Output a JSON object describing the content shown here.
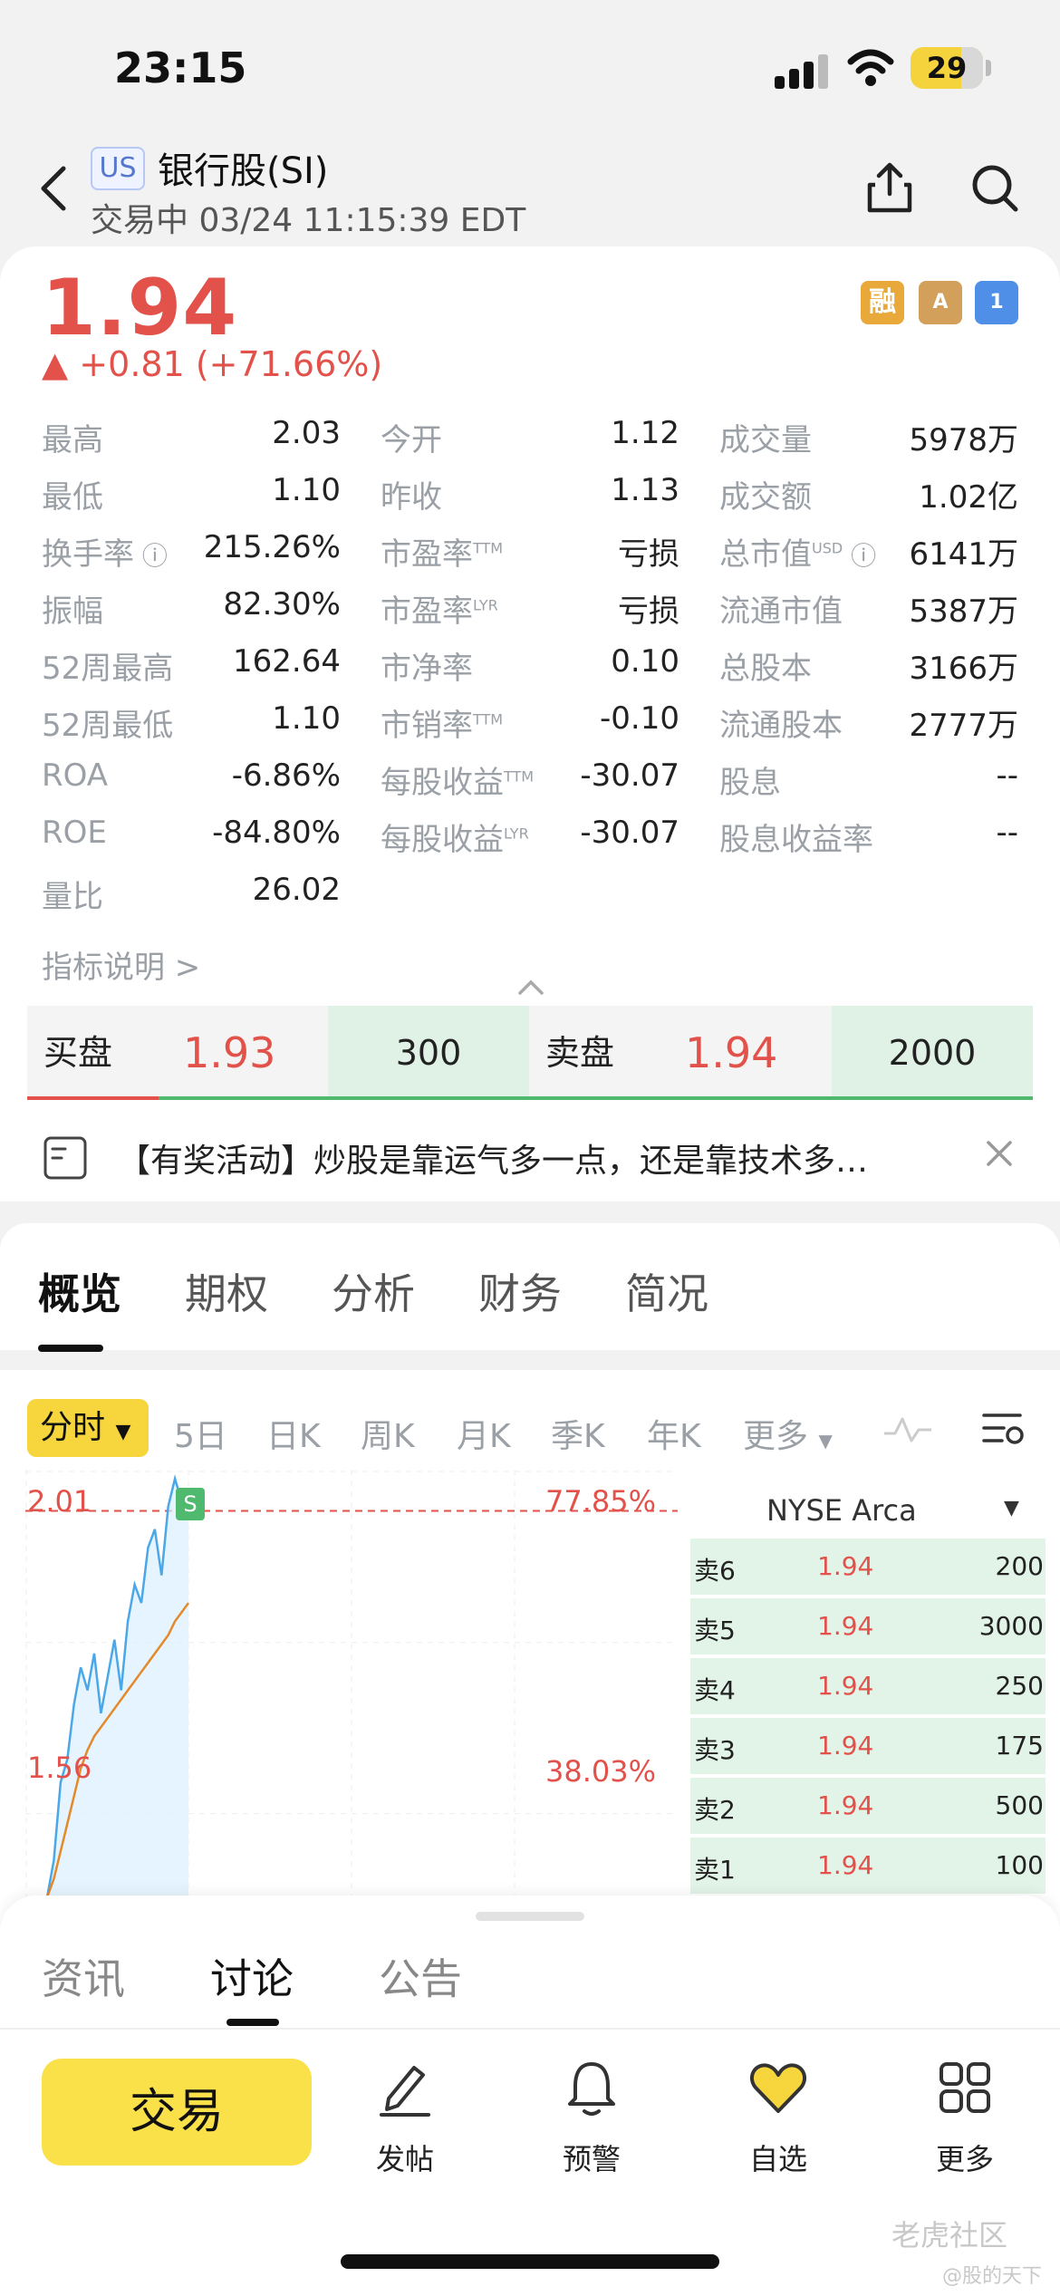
{
  "status": {
    "time": "23:15",
    "battery": "29"
  },
  "header": {
    "market": "US",
    "name": "银行股(SI)",
    "subtitle": "交易中 03/24 11:15:39 EDT"
  },
  "quote": {
    "price": "1.94",
    "change": "▲ +0.81 (+71.66%)",
    "badges": [
      "融",
      "A",
      "1"
    ]
  },
  "stats": {
    "col1": [
      {
        "label": "最高",
        "value": "2.03"
      },
      {
        "label": "最低",
        "value": "1.10"
      },
      {
        "label": "换手率",
        "value": "215.26%"
      },
      {
        "label": "振幅",
        "value": "82.30%"
      },
      {
        "label": "52周最高",
        "value": "162.64"
      },
      {
        "label": "52周最低",
        "value": "1.10"
      },
      {
        "label": "ROA",
        "value": "-6.86%"
      },
      {
        "label": "ROE",
        "value": "-84.80%"
      },
      {
        "label": "量比",
        "value": "26.02"
      }
    ],
    "col2": [
      {
        "label": "今开",
        "value": "1.12",
        "sup": ""
      },
      {
        "label": "昨收",
        "value": "1.13",
        "sup": ""
      },
      {
        "label": "市盈率",
        "value": "亏损",
        "sup": "TTM"
      },
      {
        "label": "市盈率",
        "value": "亏损",
        "sup": "LYR"
      },
      {
        "label": "市净率",
        "value": "0.10",
        "sup": ""
      },
      {
        "label": "市销率",
        "value": "-0.10",
        "sup": "TTM"
      },
      {
        "label": "每股收益",
        "value": "-30.07",
        "sup": "TTM"
      },
      {
        "label": "每股收益",
        "value": "-30.07",
        "sup": "LYR"
      }
    ],
    "col3": [
      {
        "label": "成交量",
        "value": "5978万",
        "sup": ""
      },
      {
        "label": "成交额",
        "value": "1.02亿",
        "sup": ""
      },
      {
        "label": "总市值",
        "value": "6141万",
        "sup": "USD"
      },
      {
        "label": "流通市值",
        "value": "5387万",
        "sup": ""
      },
      {
        "label": "总股本",
        "value": "3166万",
        "sup": ""
      },
      {
        "label": "流通股本",
        "value": "2777万",
        "sup": ""
      },
      {
        "label": "股息",
        "value": "--",
        "sup": ""
      },
      {
        "label": "股息收益率",
        "value": "--",
        "sup": ""
      }
    ],
    "indicator_link": "指标说明 >"
  },
  "orderbook": {
    "bid_label": "买盘",
    "bid_price": "1.93",
    "bid_size": "300",
    "ask_label": "卖盘",
    "ask_price": "1.94",
    "ask_size": "2000"
  },
  "banner": {
    "text": "【有奖活动】炒股是靠运气多一点，还是靠技术多…"
  },
  "tabs": [
    "概览",
    "期权",
    "分析",
    "财务",
    "简况"
  ],
  "periods": {
    "active": "分时",
    "items": [
      "5日",
      "日K",
      "周K",
      "月K",
      "季K",
      "年K",
      "更多"
    ]
  },
  "chart": {
    "exchange": "NYSE Arca",
    "y_high_label": "2.01",
    "y_mid_label": "1.56",
    "pct_high_label": "77.85%",
    "pct_mid_label": "38.03%",
    "marker": "S"
  },
  "chart_data": {
    "type": "line",
    "series": [
      {
        "values": [
          1.1,
          1.18,
          1.35,
          1.4,
          1.52,
          1.6,
          1.55,
          1.63,
          1.5,
          1.58,
          1.66,
          1.55,
          1.7,
          1.78,
          1.74,
          1.86,
          1.9,
          1.8,
          1.95,
          2.01,
          1.96,
          1.94
        ]
      },
      {
        "values": [
          1.1,
          1.14,
          1.2,
          1.26,
          1.32,
          1.38,
          1.42,
          1.45,
          1.47,
          1.49,
          1.51,
          1.53,
          1.55,
          1.57,
          1.59,
          1.61,
          1.63,
          1.65,
          1.67,
          1.7,
          1.72,
          1.74
        ]
      }
    ],
    "ylim": [
      1.1,
      2.01
    ],
    "reference_price": 1.94,
    "grid": true
  },
  "book": [
    {
      "label": "卖6",
      "price": "1.94",
      "size": "200"
    },
    {
      "label": "卖5",
      "price": "1.94",
      "size": "3000"
    },
    {
      "label": "卖4",
      "price": "1.94",
      "size": "250"
    },
    {
      "label": "卖3",
      "price": "1.94",
      "size": "175"
    },
    {
      "label": "卖2",
      "price": "1.94",
      "size": "500"
    },
    {
      "label": "卖1",
      "price": "1.94",
      "size": "100"
    }
  ],
  "bottom_tabs": [
    "资讯",
    "讨论",
    "公告"
  ],
  "nav": {
    "trade": "交易",
    "items": [
      "发帖",
      "预警",
      "自选",
      "更多"
    ]
  },
  "watermark": {
    "line1": "老虎社区",
    "line2": "@股的天下"
  },
  "colors": {
    "up": "#e2524b",
    "green_bg": "#dff2e5",
    "accent": "#f7d63d"
  }
}
